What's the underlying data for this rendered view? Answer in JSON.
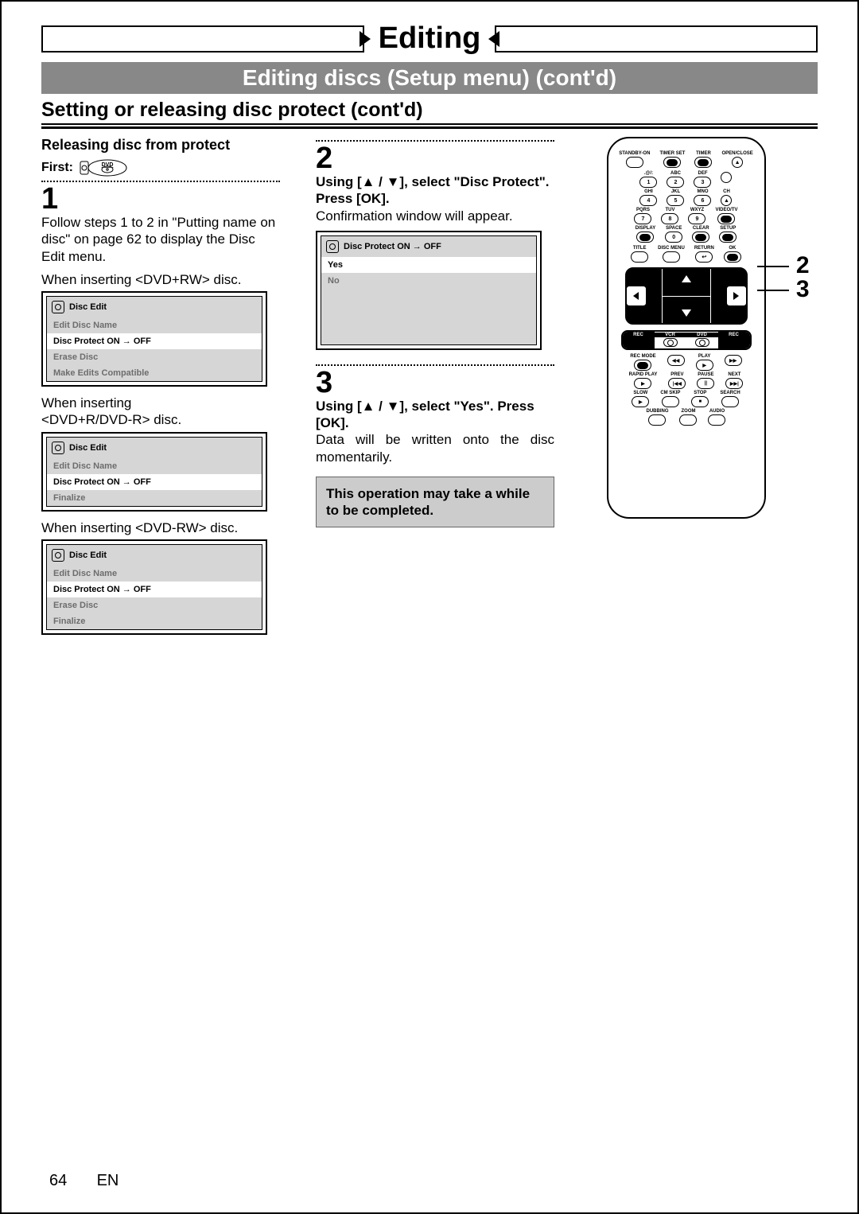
{
  "chapter": "Editing",
  "section": "Editing discs (Setup menu) (cont'd)",
  "subsection": "Setting or releasing disc protect (cont'd)",
  "releasing_title": "Releasing disc from protect",
  "first_label": "First:",
  "dvd_badge_label": "DVD",
  "step1": {
    "num": "1",
    "para": "Follow steps 1 to 2 in \"Putting name on disc\" on page 62 to display the Disc Edit menu.",
    "when_rw_plus": "When inserting <DVD+RW> disc.",
    "when_r_dvdr": "When inserting\n<DVD+R/DVD-R> disc.",
    "when_rw_minus": "When inserting <DVD-RW> disc."
  },
  "step2": {
    "num": "2",
    "title": "Using [▲ / ▼], select \"Disc Protect\". Press [OK].",
    "para": "Confirmation window will appear."
  },
  "step3": {
    "num": "3",
    "title": "Using [▲ / ▼], select \"Yes\". Press [OK].",
    "para": "Data will be written onto the disc momentarily.",
    "note": "This operation may take a while to be completed."
  },
  "menu_discEdit_title": "Disc Edit",
  "menu_discProtect_title_pre": "Disc Protect ON",
  "menu_discProtect_title_post": "OFF",
  "menu_items_rwplus": [
    {
      "label": "Edit Disc Name",
      "active": false
    },
    {
      "label": "Disc Protect ON  →  OFF",
      "active": true
    },
    {
      "label": "Erase Disc",
      "active": false
    },
    {
      "label": "Make Edits Compatible",
      "active": false
    }
  ],
  "menu_items_dvdr": [
    {
      "label": "Edit Disc Name",
      "active": false
    },
    {
      "label": "Disc Protect ON  →  OFF",
      "active": true
    },
    {
      "label": "Finalize",
      "active": false
    }
  ],
  "menu_items_rwminus": [
    {
      "label": "Edit Disc Name",
      "active": false
    },
    {
      "label": "Disc Protect ON  →  OFF",
      "active": true
    },
    {
      "label": "Erase Disc",
      "active": false
    },
    {
      "label": "Finalize",
      "active": false
    }
  ],
  "confirm_items": [
    {
      "label": "Yes",
      "active": true
    },
    {
      "label": "No",
      "active": false
    }
  ],
  "remote": {
    "top_labels": [
      "STANDBY-ON",
      "TIMER SET",
      "TIMER",
      "OPEN/CLOSE"
    ],
    "row2_labels": [
      ".@/:",
      "ABC",
      "DEF",
      ""
    ],
    "row2_nums": [
      "1",
      "2",
      "3",
      ""
    ],
    "row3_labels": [
      "GHI",
      "JKL",
      "MNO",
      "CH"
    ],
    "row3_nums": [
      "4",
      "5",
      "6",
      ""
    ],
    "row4_labels": [
      "PQRS",
      "TUV",
      "WXYZ",
      "VIDEO/TV"
    ],
    "row4_nums": [
      "7",
      "8",
      "9",
      ""
    ],
    "row5_labels": [
      "DISPLAY",
      "SPACE",
      "CLEAR",
      "SETUP"
    ],
    "row5_nums": [
      "",
      "0",
      "",
      ""
    ],
    "row6_labels": [
      "TITLE",
      "DISC MENU",
      "RETURN",
      "OK"
    ],
    "mode_labels": [
      "REC",
      "VCR",
      "DVD",
      "REC"
    ],
    "rowA_labels": [
      "REC MODE",
      "",
      "PLAY",
      ""
    ],
    "rowB_labels": [
      "RAPID PLAY",
      "PREV",
      "PAUSE",
      "NEXT"
    ],
    "rowC_labels": [
      "SLOW",
      "CM SKIP",
      "STOP",
      "SEARCH"
    ],
    "rowD_labels": [
      "DUBBING",
      "ZOOM",
      "AUDIO"
    ],
    "eject": "▲",
    "ch_up": "▲",
    "ch_dn": "▼"
  },
  "callouts": {
    "c2": "2",
    "c3": "3"
  },
  "footer": {
    "page": "64",
    "lang": "EN"
  }
}
